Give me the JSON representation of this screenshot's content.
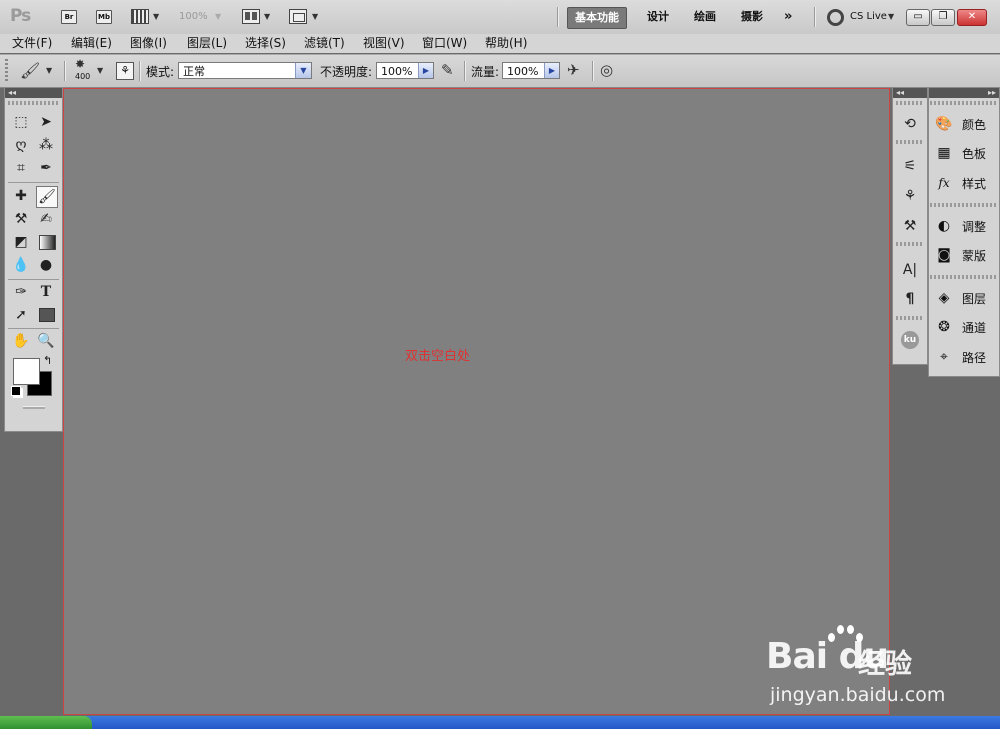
{
  "appbar": {
    "logo": "Ps",
    "br_label": "Br",
    "mb_label": "Mb",
    "zoom": "100%",
    "workspaces": [
      "基本功能",
      "设计",
      "绘画",
      "摄影"
    ],
    "more": "»",
    "cslive": "CS Live",
    "window_buttons": {
      "minimize": "▭",
      "restore": "❐",
      "close": "✕"
    }
  },
  "menu": [
    "文件(F)",
    "编辑(E)",
    "图像(I)",
    "图层(L)",
    "选择(S)",
    "滤镜(T)",
    "视图(V)",
    "窗口(W)",
    "帮助(H)"
  ],
  "options": {
    "brush_size": "400",
    "mode_label": "模式:",
    "mode_value": "正常",
    "opacity_label": "不透明度:",
    "opacity_value": "100%",
    "flow_label": "流量:",
    "flow_value": "100%"
  },
  "canvas": {
    "annotation": "双击空白处",
    "annotation_color": "#dd3333"
  },
  "right_panels": [
    {
      "icon": "palette-icon",
      "label": "颜色"
    },
    {
      "icon": "swatches-icon",
      "label": "色板"
    },
    {
      "icon": "fx-icon",
      "label": "样式"
    },
    {
      "icon": "adjustments-icon",
      "label": "调整"
    },
    {
      "icon": "mask-icon",
      "label": "蒙版"
    },
    {
      "icon": "layers-icon",
      "label": "图层"
    },
    {
      "icon": "channels-icon",
      "label": "通道"
    },
    {
      "icon": "paths-icon",
      "label": "路径"
    }
  ],
  "dock_icons": {
    "text_a": "A|",
    "paragraph": "¶",
    "kuler": "ku"
  },
  "tools": {
    "type_label": "T"
  },
  "watermark": {
    "brand": "Bai  du",
    "cn": "经验",
    "url": "jingyan.baidu.com"
  }
}
